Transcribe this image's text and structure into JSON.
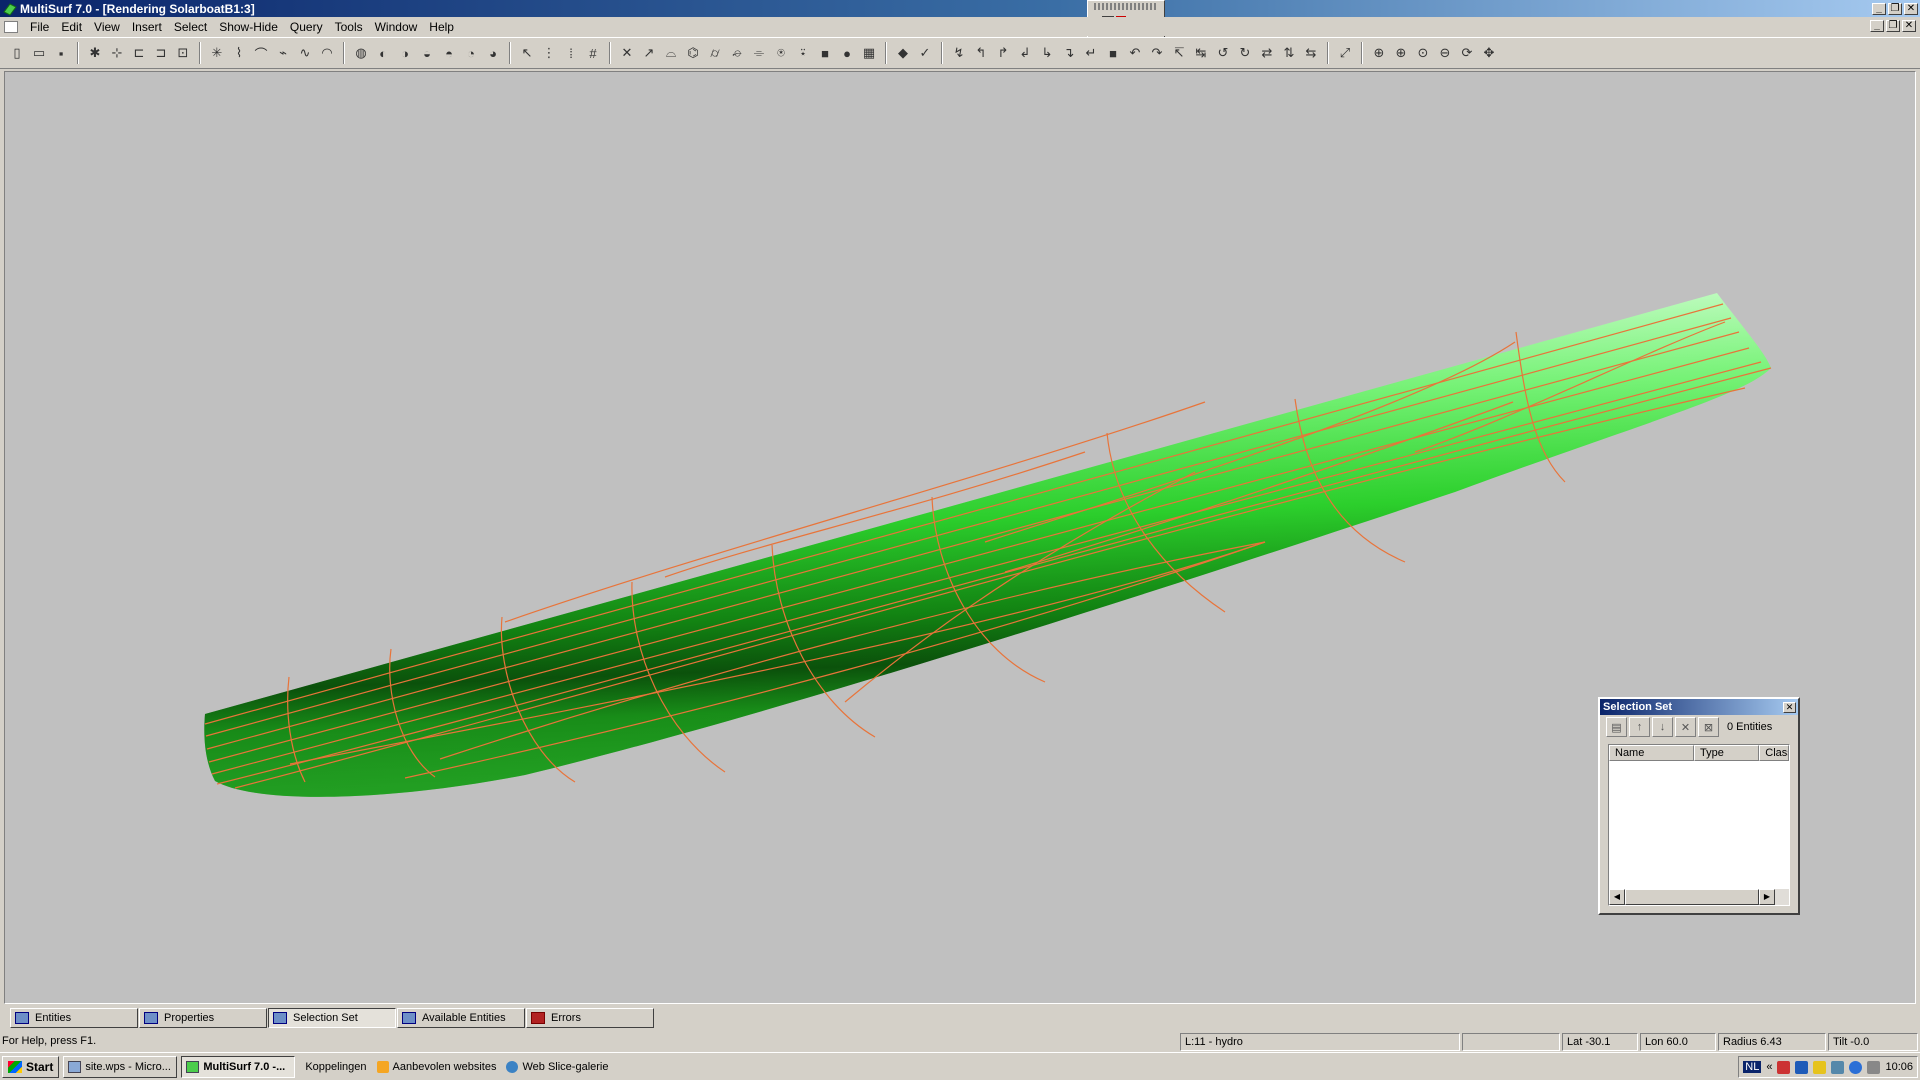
{
  "window": {
    "title": "MultiSurf 7.0 - [Rendering SolarboatB1:3]",
    "controls": [
      "_",
      "❐",
      "✕"
    ]
  },
  "menu": [
    "File",
    "Edit",
    "View",
    "Insert",
    "Select",
    "Show-Hide",
    "Query",
    "Tools",
    "Window",
    "Help"
  ],
  "colors": {
    "hull_light": "#d8ffd8",
    "hull_mid": "#33e633",
    "hull_dark": "#0a4d0a",
    "contour": "#e8743a",
    "viewport_bg": "#c0c0c0"
  },
  "selection_set": {
    "title": "Selection Set",
    "count": "0 Entities",
    "columns": [
      "Name",
      "Type",
      "Class"
    ]
  },
  "tabs": [
    {
      "label": "Entities",
      "active": false
    },
    {
      "label": "Properties",
      "active": false
    },
    {
      "label": "Selection Set",
      "active": true
    },
    {
      "label": "Available Entities",
      "active": false
    },
    {
      "label": "Errors",
      "active": false
    }
  ],
  "status": {
    "help": "For Help, press F1.",
    "layer": "L:11 - hydro",
    "lat": "Lat -30.1",
    "lon": "Lon 60.0",
    "radius": "Radius 6.43",
    "tilt": "Tilt -0.0"
  },
  "taskbar": {
    "start": "Start",
    "tasks": [
      {
        "label": "site.wps - Micro...",
        "active": false
      },
      {
        "label": "MultiSurf 7.0 -...",
        "active": true
      }
    ],
    "links": [
      "Koppelingen",
      "Aanbevolen websites",
      "Web Slice-galerie"
    ],
    "lang": "NL",
    "clock": "10:06"
  }
}
